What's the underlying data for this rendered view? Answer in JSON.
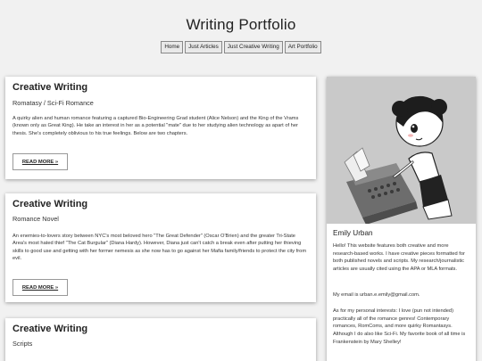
{
  "site": {
    "title": "Writing Portfolio"
  },
  "nav": {
    "items": [
      {
        "label": "Home"
      },
      {
        "label": "Just Articles"
      },
      {
        "label": "Just Creative Writing"
      },
      {
        "label": "Art Portfolio"
      }
    ]
  },
  "posts": [
    {
      "title": "Creative Writing",
      "subtitle": "Romatasy / Sci-Fi Romance",
      "body": "A quirky alien and human romance featuring a captured Bio-Engineering Grad student (Alice Nelson) and the King of the Vrams (known only as Great King). He take an interest in her as a potential \"mate\" due to her studying alien technology as apart of her thesis. She's completely oblivious to his true feelings. Below are two chapters.",
      "read_more": "READ MORE »"
    },
    {
      "title": "Creative Writing",
      "subtitle": "Romance Novel",
      "body": "An enemies-to-lovers story between NYC's most beloved hero \"The Great Defender\" (Oscar O'Brien) and the greater Tri-State Area's most hated thief \"The Cat Burgular\" (Diana Hardy). However, Diana just can't catch a break even after putting her thieving skills to good use and getting with her former nemesis as she now has to go against her Mafia family/friends to protect the city from evil.",
      "read_more": "READ MORE »"
    },
    {
      "title": "Creative Writing",
      "subtitle": "Scripts"
    }
  ],
  "sidebar": {
    "name": "Emily Urban",
    "paragraphs": [
      "Hello! This website features both creative and more research-based works. I have creative pieces formatted for both published novels and scripts. My research/journalistic articles are usually cited using the APA or MLA formats.",
      "My email is urban.e.emily@gmail.com.",
      "As for my personal interests: I love (pun not intended) practically all of the romance genres! Contemporary romances, RomComs, and more quirky Romantasys. Although I do also like Sci-Fi. My favorite book of all time is Frankenstein by Mary Shelley!"
    ]
  },
  "colors": {
    "background": "#f1f1f1",
    "card": "#ffffff",
    "avatar_bg": "#c9c9c9",
    "nav_bg": "#e9e9e9"
  }
}
